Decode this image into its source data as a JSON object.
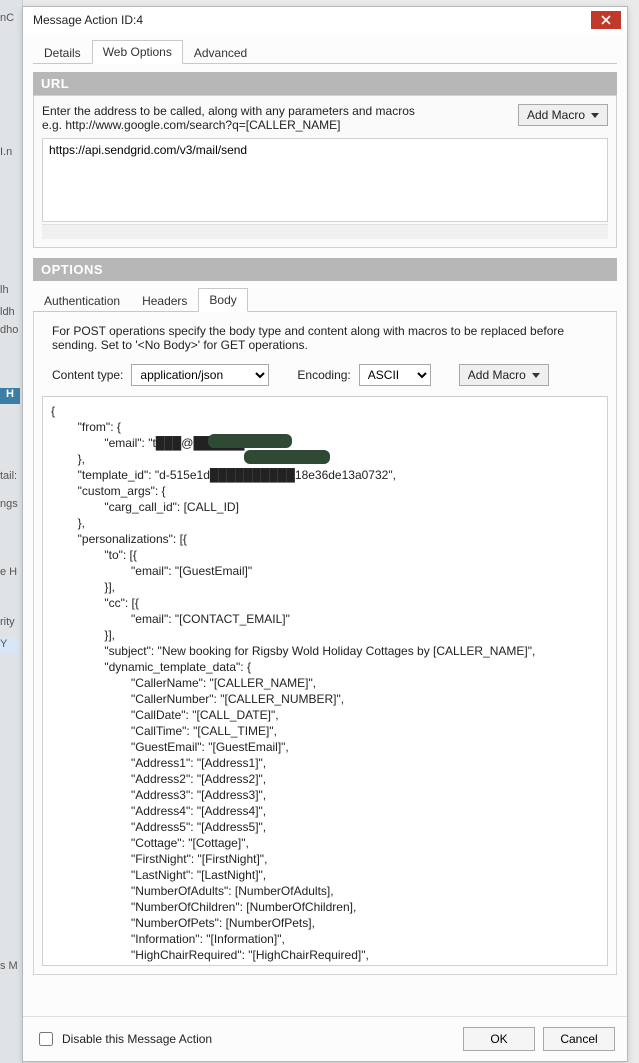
{
  "background_hints": {
    "h1": "nC",
    "h2": "I.n",
    "h3": "lh",
    "h4": "ldh",
    "h5": "dho",
    "h6": "H",
    "h7": "tail:",
    "h8": "ngs",
    "h9": "e H",
    "h10": "rity",
    "h11": "Y",
    "h12": "s M"
  },
  "dialog": {
    "title": "Message Action  ID:4",
    "main_tabs": [
      {
        "label": "Details",
        "active": false
      },
      {
        "label": "Web Options",
        "active": true
      },
      {
        "label": "Advanced",
        "active": false
      }
    ],
    "url_section": {
      "header": "URL",
      "help_line1": "Enter the address to be called, along with any parameters and macros",
      "help_line2": "e.g. http://www.google.com/search?q=[CALLER_NAME]",
      "add_macro": "Add Macro",
      "value": "https://api.sendgrid.com/v3/mail/send"
    },
    "options_section": {
      "header": "OPTIONS",
      "tabs": [
        {
          "label": "Authentication",
          "active": false
        },
        {
          "label": "Headers",
          "active": false
        },
        {
          "label": "Body",
          "active": true
        }
      ],
      "post_help": "For POST operations specify the body type and content along with macros to be replaced before sending.  Set to '<No Body>' for GET operations.",
      "content_type_label": "Content type:",
      "content_type_value": "application/json",
      "encoding_label": "Encoding:",
      "encoding_value": "ASCII",
      "add_macro": "Add Macro",
      "body_value": "{\n        \"from\": {\n                \"email\": \"t███@██████.com\"\n        },\n        \"template_id\": \"d-515e1d██████████18e36de13a0732\",\n        \"custom_args\": {\n                \"carg_call_id\": [CALL_ID]\n        },\n        \"personalizations\": [{\n                \"to\": [{\n                        \"email\": \"[GuestEmail]\"\n                }],\n                \"cc\": [{\n                        \"email\": \"[CONTACT_EMAIL]\"\n                }],\n                \"subject\": \"New booking for Rigsby Wold Holiday Cottages by [CALLER_NAME]\",\n                \"dynamic_template_data\": {\n                        \"CallerName\": \"[CALLER_NAME]\",\n                        \"CallerNumber\": \"[CALLER_NUMBER]\",\n                        \"CallDate\": \"[CALL_DATE]\",\n                        \"CallTime\": \"[CALL_TIME]\",\n                        \"GuestEmail\": \"[GuestEmail]\",\n                        \"Address1\": \"[Address1]\",\n                        \"Address2\": \"[Address2]\",\n                        \"Address3\": \"[Address3]\",\n                        \"Address4\": \"[Address4]\",\n                        \"Address5\": \"[Address5]\",\n                        \"Cottage\": \"[Cottage]\",\n                        \"FirstNight\": \"[FirstNight]\",\n                        \"LastNight\": \"[LastNight]\",\n                        \"NumberOfAdults\": [NumberOfAdults],\n                        \"NumberOfChildren\": [NumberOfChildren],\n                        \"NumberOfPets\": [NumberOfPets],\n                        \"Information\": \"[Information]\",\n                        \"HighChairRequired\": \"[HighChairRequired]\",\n                        \"TravelCotRequired\": \"[TravelCotRequired]\",\n                        \"HotTubRequired\": \"[HotTubRequired]\",\n                        \"ECChargingRequired\": \"[ECChargingRequired]\"\n                }\n        }]\n}"
    },
    "footer": {
      "disable_label": "Disable this Message Action",
      "disable_checked": false,
      "ok": "OK",
      "cancel": "Cancel"
    }
  }
}
